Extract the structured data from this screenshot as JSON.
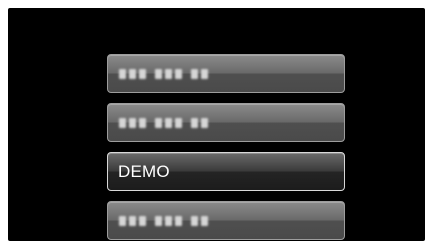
{
  "menu": {
    "items": [
      {
        "label": "",
        "blurred": true
      },
      {
        "label": "",
        "blurred": true
      },
      {
        "label": "DEMO",
        "blurred": false,
        "selected": true
      },
      {
        "label": "",
        "blurred": true
      }
    ]
  }
}
